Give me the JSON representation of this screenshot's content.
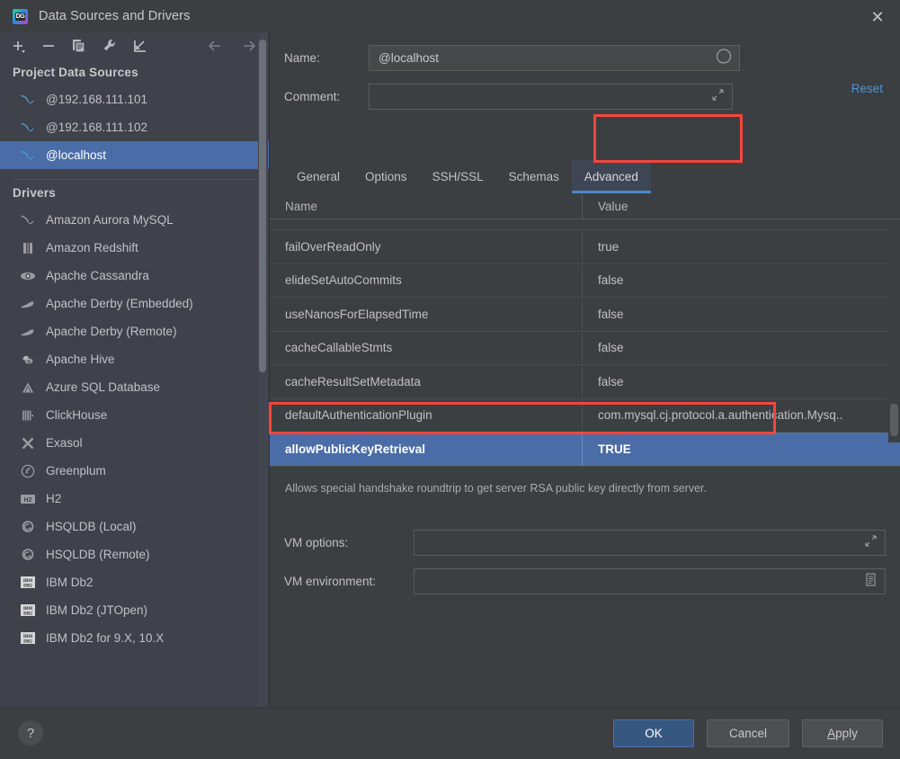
{
  "window": {
    "title": "Data Sources and Drivers",
    "app_icon": "datagrip-icon",
    "close_icon": "close-icon"
  },
  "sidebar": {
    "toolbar": [
      {
        "name": "add-button",
        "icon": "plus-icon"
      },
      {
        "name": "remove-button",
        "icon": "minus-icon"
      },
      {
        "name": "copy-button",
        "icon": "copy-icon"
      },
      {
        "name": "properties-button",
        "icon": "wrench-icon"
      },
      {
        "name": "jump-button",
        "icon": "arrow-into-corner-icon"
      }
    ],
    "nav": [
      {
        "name": "back-button",
        "icon": "arrow-left-icon"
      },
      {
        "name": "forward-button",
        "icon": "arrow-right-icon"
      }
    ],
    "project_section_title": "Project Data Sources",
    "data_sources": [
      {
        "label": "@192.168.111.101",
        "icon": "mysql-dolphin-icon",
        "selected": false
      },
      {
        "label": "@192.168.111.102",
        "icon": "mysql-dolphin-icon",
        "selected": false
      },
      {
        "label": "@localhost",
        "icon": "mysql-dolphin-icon",
        "selected": true
      }
    ],
    "drivers_section_title": "Drivers",
    "drivers": [
      {
        "label": "Amazon Aurora MySQL",
        "icon": "mysql-dolphin-icon"
      },
      {
        "label": "Amazon Redshift",
        "icon": "redshift-icon"
      },
      {
        "label": "Apache Cassandra",
        "icon": "cassandra-eye-icon"
      },
      {
        "label": "Apache Derby (Embedded)",
        "icon": "derby-hat-icon"
      },
      {
        "label": "Apache Derby (Remote)",
        "icon": "derby-hat-icon"
      },
      {
        "label": "Apache Hive",
        "icon": "hive-bee-icon"
      },
      {
        "label": "Azure SQL Database",
        "icon": "azure-triangle-icon"
      },
      {
        "label": "ClickHouse",
        "icon": "clickhouse-bars-icon"
      },
      {
        "label": "Exasol",
        "icon": "exasol-x-icon"
      },
      {
        "label": "Greenplum",
        "icon": "greenplum-circle-icon"
      },
      {
        "label": "H2",
        "icon": "h2-badge-icon"
      },
      {
        "label": "HSQLDB (Local)",
        "icon": "hsqldb-icon"
      },
      {
        "label": "HSQLDB (Remote)",
        "icon": "hsqldb-icon"
      },
      {
        "label": "IBM Db2",
        "icon": "ibm-db2-icon"
      },
      {
        "label": "IBM Db2 (JTOpen)",
        "icon": "ibm-db2-icon"
      },
      {
        "label": "IBM Db2 for 9.X, 10.X",
        "icon": "ibm-db2-icon"
      }
    ]
  },
  "details": {
    "name_label": "Name:",
    "name_value": "@localhost",
    "name_placeholder": "",
    "name_status_icon": "circle-icon",
    "comment_label": "Comment:",
    "comment_value": "",
    "comment_placeholder": "",
    "comment_expand_icon": "expand-icon",
    "reset_label": "Reset",
    "tabs": [
      {
        "label": "General",
        "active": false
      },
      {
        "label": "Options",
        "active": false
      },
      {
        "label": "SSH/SSL",
        "active": false
      },
      {
        "label": "Schemas",
        "active": false
      },
      {
        "label": "Advanced",
        "active": true
      }
    ],
    "table": {
      "columns": [
        "Name",
        "Value"
      ],
      "rows": [
        {
          "name": "failOverReadOnly",
          "value": "true",
          "selected": false
        },
        {
          "name": "elideSetAutoCommits",
          "value": "false",
          "selected": false
        },
        {
          "name": "useNanosForElapsedTime",
          "value": "false",
          "selected": false
        },
        {
          "name": "cacheCallableStmts",
          "value": "false",
          "selected": false
        },
        {
          "name": "cacheResultSetMetadata",
          "value": "false",
          "selected": false
        },
        {
          "name": "defaultAuthenticationPlugin",
          "value": "com.mysql.cj.protocol.a.authentication.Mysq..",
          "selected": false
        },
        {
          "name": "allowPublicKeyRetrieval",
          "value": "TRUE",
          "selected": true
        }
      ]
    },
    "hint": "Allows special handshake roundtrip to get server RSA public key directly from server.",
    "vm_options_label": "VM options:",
    "vm_options_value": "",
    "vm_options_icon": "expand-icon",
    "vm_environment_label": "VM environment:",
    "vm_environment_value": "",
    "vm_environment_icon": "list-icon"
  },
  "footer": {
    "help_label": "?",
    "ok_label": "OK",
    "cancel_label": "Cancel",
    "apply_label": "Apply",
    "apply_label_a": "A",
    "apply_label_rest": "pply"
  },
  "colors": {
    "accent_blue": "#4a6da7",
    "link_blue": "#4b94d6",
    "annotation_red": "#f4453c",
    "ok_button_blue": "#365880",
    "window_bg": "#3c3f41",
    "sidebar_bg": "#3f424a"
  }
}
